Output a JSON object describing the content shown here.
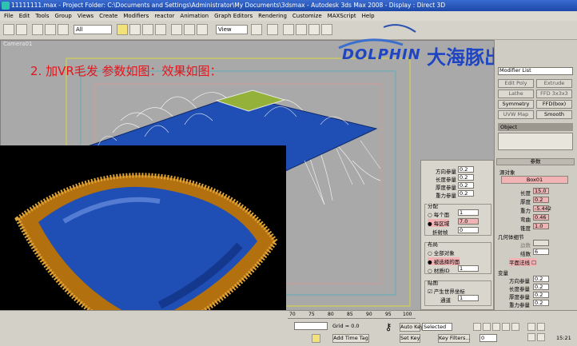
{
  "window": {
    "title": "11111111.max    - Project Folder: C:\\Documents and Settings\\Administrator\\My Documents\\3dsmax    - Autodesk 3ds Max 2008    - Display : Direct 3D"
  },
  "menu": [
    "File",
    "Edit",
    "Tools",
    "Group",
    "Views",
    "Create",
    "Modifiers",
    "reactor",
    "Animation",
    "Graph Editors",
    "Rendering",
    "Customize",
    "MAXScript",
    "Help"
  ],
  "toolbar": {
    "selection_filter": "All",
    "ref_coord": "View"
  },
  "viewport": {
    "label": "Camera01"
  },
  "caption": "2. 加VR毛发 参数如图：效果如图：",
  "logo": {
    "en": "DOLPHIN",
    "zh": "大海豚出品"
  },
  "command_panel": {
    "object_name": "Object",
    "modifier_list": "Modifier List",
    "buttons": [
      "Edit Poly",
      "Extrude",
      "Lathe",
      "FFD 3x3x3",
      "Symmetry",
      "FFD(box)",
      "UVW Map",
      "Smooth"
    ],
    "params_title": "参数",
    "source_object_label": "源对象",
    "source_object": "Box01",
    "params": [
      {
        "label": "长度",
        "value": "15.0"
      },
      {
        "label": "厚度",
        "value": "0.2"
      },
      {
        "label": "重力",
        "value": "-5.442"
      },
      {
        "label": "弯曲",
        "value": "0.46"
      },
      {
        "label": "锥度",
        "value": "1.0"
      }
    ],
    "geo_detail": "几何体细节",
    "sides_label": "边数",
    "sides_value": "",
    "knots_label": "结数",
    "knots_value": "6",
    "flat_normals": "平面法线",
    "variation": "变量",
    "variation_params": [
      {
        "label": "方向参量",
        "value": "0.2"
      },
      {
        "label": "长度参量",
        "value": "0.2"
      },
      {
        "label": "厚度参量",
        "value": "0.2"
      },
      {
        "label": "重力参量",
        "value": "0.2"
      }
    ]
  },
  "mid_panel": {
    "params": [
      {
        "label": "方向参量",
        "value": "0.2"
      },
      {
        "label": "长度参量",
        "value": "0.2"
      },
      {
        "label": "厚度参量",
        "value": "0.2"
      },
      {
        "label": "重力参量",
        "value": "0.2"
      }
    ],
    "distribution": "分配",
    "per_face": "每个面",
    "per_face_value": "1",
    "per_area": "每区域",
    "per_area_value": "7.0",
    "ref_frame": "折射帧",
    "ref_frame_value": "0",
    "placement": "布局",
    "entire_object": "全部对象",
    "selected_faces": "被选择的面",
    "material_id": "材质ID",
    "material_id_value": "1",
    "mapping": "贴图",
    "gen_world_uv": "产生世界坐标",
    "channel": "通道",
    "channel_value": "1"
  },
  "bottom": {
    "grid": "Grid = 0.0",
    "add_time_tag": "Add Time Tag",
    "auto_key": "Auto Key",
    "set_key": "Set Key",
    "selected": "Selected",
    "key_filters": "Key Filters...",
    "frame": "0",
    "time": "15:21",
    "ruler": [
      "70",
      "75",
      "80",
      "85",
      "90",
      "95",
      "100"
    ]
  },
  "colors": {
    "fur": "#b2700e",
    "cushion": "#1f4fb5",
    "titlebar": "#2350b8",
    "caption": "#e4151b"
  }
}
